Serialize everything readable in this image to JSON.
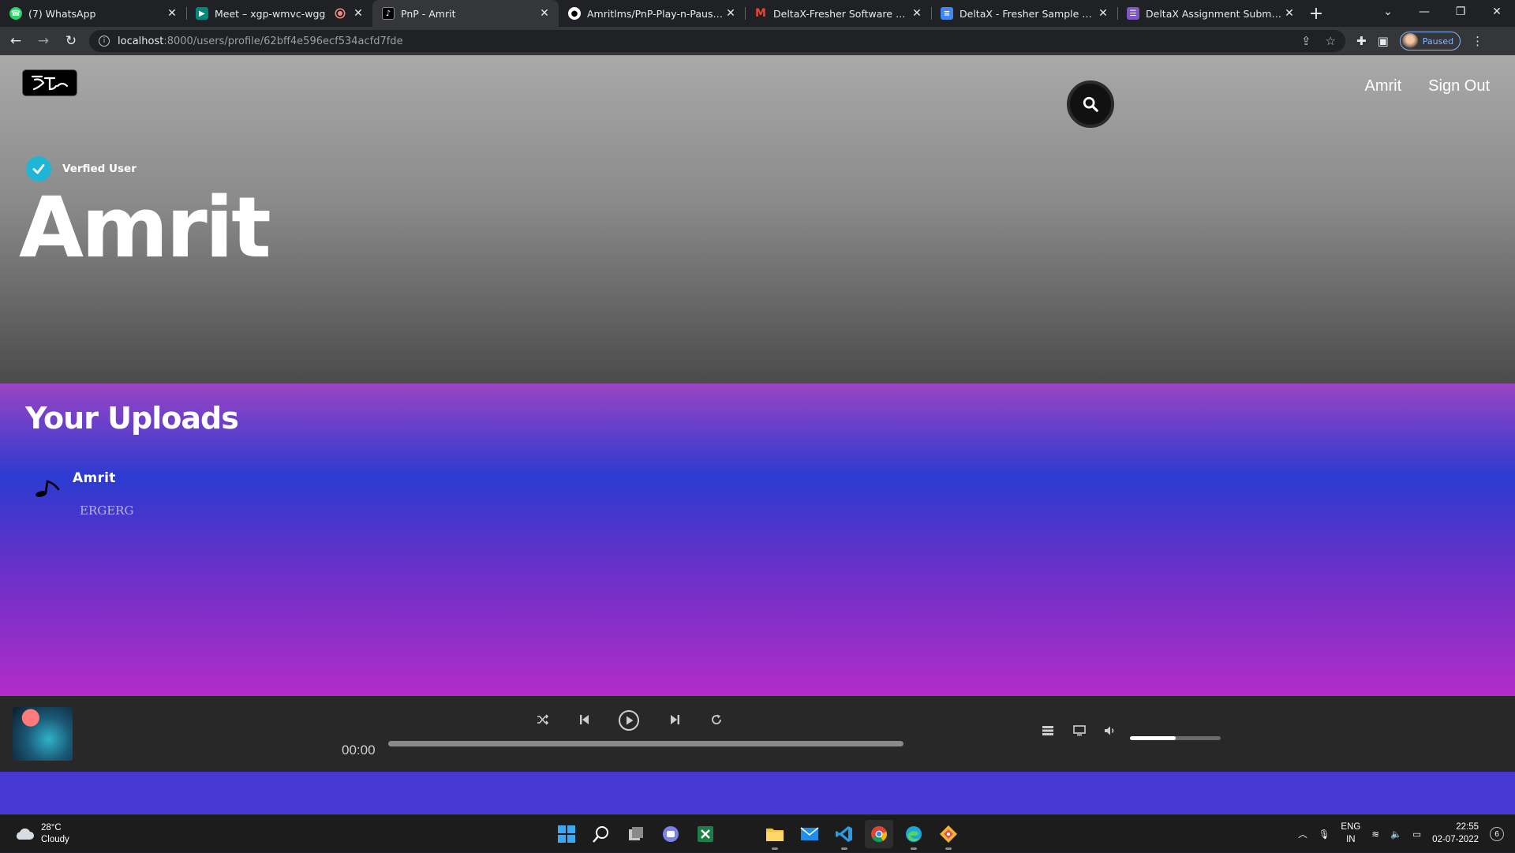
{
  "browser": {
    "tabs": [
      {
        "title": "(7) WhatsApp",
        "favicon_color": "#25d366"
      },
      {
        "title": "Meet – xgp-wmvc-wgg",
        "favicon_color": "#00897b",
        "recording": true
      },
      {
        "title": "PnP - Amrit",
        "favicon_color": "#000000",
        "active": true
      },
      {
        "title": "Amritlms/PnP-Play-n-Pause-: It a",
        "favicon_color": "#ffffff"
      },
      {
        "title": "DeltaX-Fresher Software Engine",
        "favicon_color": "#ea4335"
      },
      {
        "title": "DeltaX - Fresher Sample App - S",
        "favicon_color": "#4285f4"
      },
      {
        "title": "DeltaX Assignment Submission",
        "favicon_color": "#7e57c2"
      }
    ],
    "url_host": "localhost",
    "url_path": ":8000/users/profile/62bff4e596ecf534acfd7fde",
    "profile_status": "Paused"
  },
  "header": {
    "nav": {
      "user_link": "Amrit",
      "signout_link": "Sign Out"
    }
  },
  "profile": {
    "verified_label": "Verfied User",
    "artist_name": "Amrit"
  },
  "uploads": {
    "heading": "Your Uploads",
    "tracks": [
      {
        "title": "Amrit",
        "subtitle": "ERGERG"
      }
    ]
  },
  "player": {
    "elapsed": "00:00",
    "progress": 0,
    "volume": 0.5
  },
  "taskbar": {
    "weather_temp": "28°C",
    "weather_desc": "Cloudy",
    "lang_top": "ENG",
    "lang_bottom": "IN",
    "time": "22:55",
    "date": "02-07-2022",
    "notifications": "6"
  },
  "colors": {
    "accent_verified": "#1fb6d6",
    "hero_top": "#a9a9a9",
    "hero_bottom": "#4b4b4b",
    "uploads_top": "#9a44c4",
    "uploads_mid": "#2c3bd0",
    "uploads_bottom": "#b22cc8",
    "player_bg": "#282828"
  }
}
